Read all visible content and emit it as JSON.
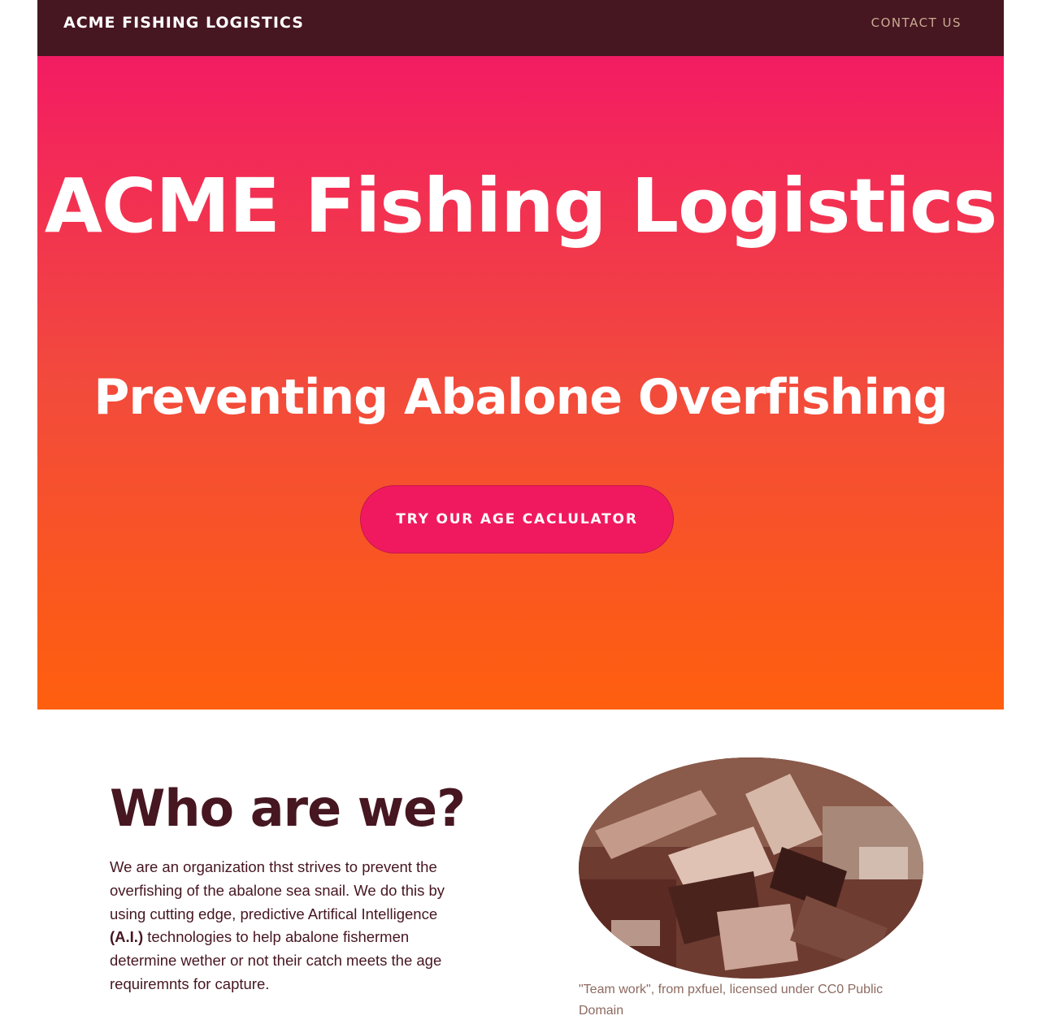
{
  "navbar": {
    "brand": "ACME FISHING LOGISTICS",
    "contact_link": "CONTACT US"
  },
  "hero": {
    "title": "ACME Fishing Logistics",
    "subtitle": "Preventing Abalone Overfishing",
    "cta_label": "TRY OUR AGE CACLULATOR"
  },
  "about": {
    "heading": "Who are we?",
    "text_before": "We are an organization thst strives to prevent the overfishing of the abalone sea snail. We do this by using cutting edge, predictive Artifical Intelligence ",
    "text_bold": "(A.I.)",
    "text_after": " technologies to help abalone fishermen determine wether or not their catch meets the age requiremnts for capture.",
    "image_caption": "\"Team work\", from pxfuel, licensed under CC0 Public Domain"
  },
  "colors": {
    "navbar_bg": "#461621",
    "hero_top": "#f31c63",
    "hero_bottom": "#ff5f0e",
    "button_bg": "#f0195f",
    "heading_text": "#461621",
    "nav_link": "#c9ac91"
  }
}
